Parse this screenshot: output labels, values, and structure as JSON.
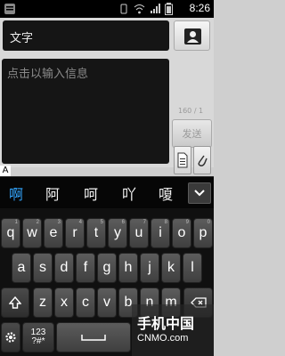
{
  "status_bar": {
    "time": "8:26"
  },
  "compose": {
    "recipient": "文字",
    "message_placeholder": "点击以输入信息",
    "char_count": "160 / 1",
    "send_label": "发送"
  },
  "ime": {
    "marker": "A",
    "candidates": [
      "啊",
      "阿",
      "呵",
      "吖",
      "嗄"
    ]
  },
  "keyboard": {
    "row1": [
      {
        "k": "q",
        "h": "1"
      },
      {
        "k": "w",
        "h": "2"
      },
      {
        "k": "e",
        "h": "3"
      },
      {
        "k": "r",
        "h": "4"
      },
      {
        "k": "t",
        "h": "5"
      },
      {
        "k": "y",
        "h": "6"
      },
      {
        "k": "u",
        "h": "7"
      },
      {
        "k": "i",
        "h": "8"
      },
      {
        "k": "o",
        "h": "9"
      },
      {
        "k": "p",
        "h": "0"
      }
    ],
    "row2": [
      "a",
      "s",
      "d",
      "f",
      "g",
      "h",
      "j",
      "k",
      "l"
    ],
    "row3": [
      "z",
      "x",
      "c",
      "v",
      "b",
      "n",
      "m"
    ],
    "num_label_top": "123",
    "num_label_bottom": "?#*"
  },
  "watermark": {
    "title": "手机中国",
    "url": "CNMO.com"
  },
  "colors": {
    "selected_candidate": "#33a6ff"
  }
}
